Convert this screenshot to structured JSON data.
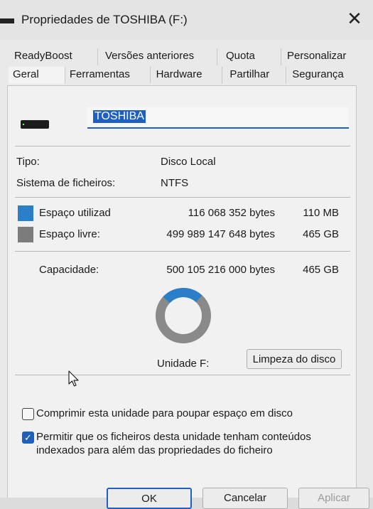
{
  "window": {
    "title": "Propriedades de TOSHIBA (F:)"
  },
  "tabs": {
    "back": [
      "ReadyBoost",
      "Versões anteriores",
      "Quota",
      "Personalizar"
    ],
    "front": [
      "Geral",
      "Ferramentas",
      "Hardware",
      "Partilhar",
      "Segurança"
    ],
    "active": "Geral"
  },
  "general": {
    "volume_name": "TOSHIBA",
    "type_label": "Tipo:",
    "type_value": "Disco Local",
    "fs_label": "Sistema de ficheiros:",
    "fs_value": "NTFS",
    "used_label": "Espaço utilizad",
    "used_bytes": "116 068 352 bytes",
    "used_size": "110 MB",
    "free_label": "Espaço livre:",
    "free_bytes": "499 989 147 648 bytes",
    "free_size": "465 GB",
    "capacity_label": "Capacidade:",
    "capacity_bytes": "500 105 216 000 bytes",
    "capacity_size": "465 GB",
    "drive_label": "Unidade F:",
    "cleanup_button": "Limpeza do disco",
    "compress_label": "Comprimir esta unidade para poupar espaço em disco",
    "compress_checked": false,
    "index_label_1": "Permitir que os ficheiros desta unidade tenham conteúdos",
    "index_label_2": "indexados para além das propriedades do ficheiro",
    "index_checked": true
  },
  "colors": {
    "used": "#2a7fc8",
    "free": "#7c7c7c",
    "accent": "#1f5fbf"
  },
  "buttons": {
    "ok": "OK",
    "cancel": "Cancelar",
    "apply": "Aplicar"
  }
}
